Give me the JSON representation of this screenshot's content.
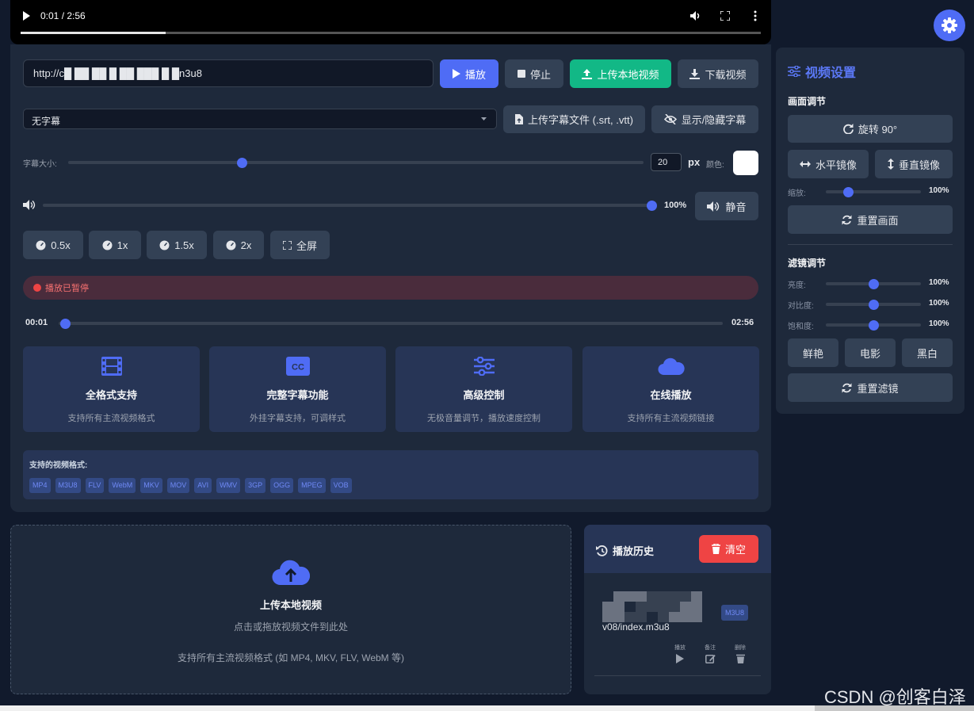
{
  "video": {
    "time": "0:01 / 2:56",
    "progress": 0.196
  },
  "url": {
    "value": "http://c█ ██ ██ █ ██ ███ █ █n3u8"
  },
  "buttons": {
    "play": "播放",
    "stop": "停止",
    "upload_local": "上传本地视频",
    "download": "下载视频",
    "upload_subtitle": "上传字幕文件 (.srt, .vtt)",
    "toggle_subtitle": "显示/隐藏字幕",
    "mute": "静音",
    "fullscreen": "全屏"
  },
  "subtitle": {
    "select_value": "无字幕",
    "size_label": "字幕大小:",
    "size_value": "20",
    "size_unit": "px",
    "size_fraction": 0.302,
    "color_label": "颜色:",
    "color_value": "#ffffff"
  },
  "volume": {
    "value": "100%",
    "fraction": 1.0
  },
  "speeds": [
    "0.5x",
    "1x",
    "1.5x",
    "2x"
  ],
  "status": {
    "text": "播放已暂停",
    "color": "#ef4444"
  },
  "progress": {
    "current": "00:01",
    "total": "02:56",
    "fraction": 0.01
  },
  "features": [
    {
      "icon": "film-icon",
      "title": "全格式支持",
      "desc": "支持所有主流视频格式"
    },
    {
      "icon": "closed-caption-icon",
      "title": "完整字幕功能",
      "desc": "外挂字幕支持，可调样式"
    },
    {
      "icon": "sliders-icon",
      "title": "高级控制",
      "desc": "无极音量调节，播放速度控制"
    },
    {
      "icon": "cloud-icon",
      "title": "在线播放",
      "desc": "支持所有主流视频链接"
    }
  ],
  "formats": {
    "heading": "支持的视频格式:",
    "list": [
      "MP4",
      "M3U8",
      "FLV",
      "WebM",
      "MKV",
      "MOV",
      "AVI",
      "WMV",
      "3GP",
      "OGG",
      "MPEG",
      "VOB"
    ]
  },
  "upload": {
    "title": "上传本地视频",
    "subtitle": "点击或拖放视频文件到此处",
    "support": "支持所有主流视频格式 (如 MP4, MKV, FLV, WebM 等)"
  },
  "history": {
    "title": "播放历史",
    "clear": "清空",
    "item": {
      "url": "v08/index.m3u8",
      "badge": "M3U8",
      "actions": [
        "播放",
        "备注",
        "删除"
      ]
    }
  },
  "settings": {
    "title": "视频设置",
    "picture_section": "画面调节",
    "rotate": "旋转 90°",
    "flip_h": "水平镜像",
    "flip_v": "垂直镜像",
    "zoom_label": "缩放:",
    "zoom_value": "100%",
    "zoom_fraction": 0.235,
    "reset_picture": "重置画面",
    "filter_section": "滤镜调节",
    "filters": [
      {
        "label": "亮度:",
        "value": "100%",
        "fraction": 0.5
      },
      {
        "label": "对比度:",
        "value": "100%",
        "fraction": 0.5
      },
      {
        "label": "饱和度:",
        "value": "100%",
        "fraction": 0.5
      }
    ],
    "presets": [
      "鲜艳",
      "电影",
      "黑白"
    ],
    "reset_filter": "重置滤镜"
  },
  "watermark": "CSDN @创客白泽",
  "colors": {
    "accent": "#4f6cf5",
    "success": "#12b886",
    "danger": "#ef4444",
    "panel": "#1e293b"
  }
}
